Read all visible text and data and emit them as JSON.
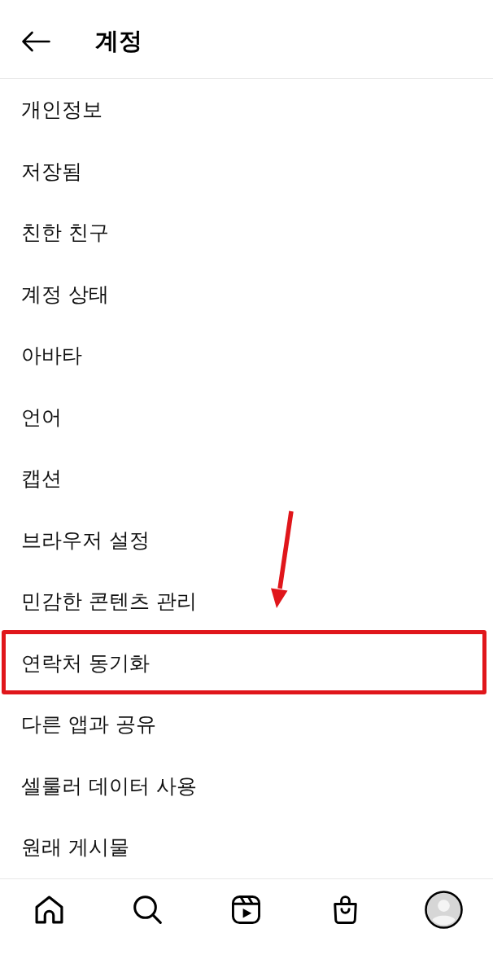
{
  "header": {
    "title": "계정"
  },
  "menu": {
    "items": [
      {
        "label": "개인정보",
        "highlighted": false
      },
      {
        "label": "저장됨",
        "highlighted": false
      },
      {
        "label": "친한 친구",
        "highlighted": false
      },
      {
        "label": "계정 상태",
        "highlighted": false
      },
      {
        "label": "아바타",
        "highlighted": false
      },
      {
        "label": "언어",
        "highlighted": false
      },
      {
        "label": "캡션",
        "highlighted": false
      },
      {
        "label": "브라우저 설정",
        "highlighted": false
      },
      {
        "label": "민감한 콘텐츠 관리",
        "highlighted": false
      },
      {
        "label": "연락처 동기화",
        "highlighted": true
      },
      {
        "label": "다른 앱과 공유",
        "highlighted": false
      },
      {
        "label": "셀룰러 데이터 사용",
        "highlighted": false
      },
      {
        "label": "원래 게시물",
        "highlighted": false
      }
    ]
  },
  "nav": {
    "tabs": [
      {
        "kind": "home",
        "selected": false
      },
      {
        "kind": "search",
        "selected": false
      },
      {
        "kind": "reels",
        "selected": false
      },
      {
        "kind": "shop",
        "selected": false
      },
      {
        "kind": "profile",
        "selected": true
      }
    ]
  }
}
